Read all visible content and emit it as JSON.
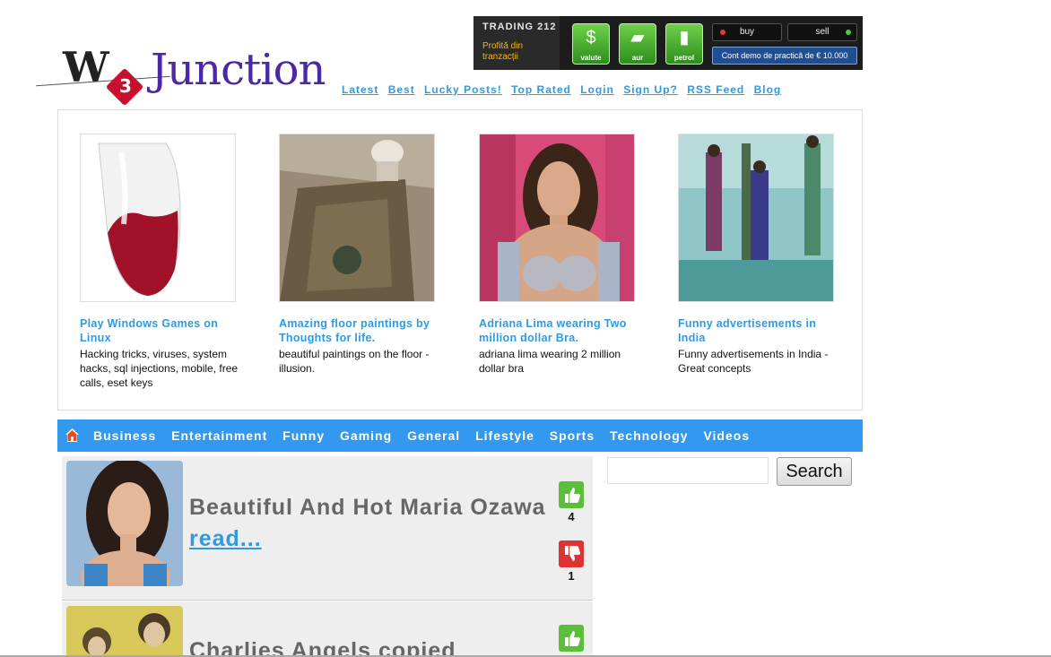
{
  "logo": {
    "w_text": "W",
    "number": "3",
    "name": "Junction"
  },
  "topnav": [
    "Latest",
    "Best",
    "Lucky Posts!",
    "Top Rated",
    "Login",
    "Sign Up?",
    "RSS Feed",
    "Blog"
  ],
  "ad": {
    "brand": "TRADING 212",
    "tagline": "Profită din tranzacții",
    "tiles": [
      {
        "label": "valute",
        "icon": "dollar-icon"
      },
      {
        "label": "aur",
        "icon": "gold-bar-icon"
      },
      {
        "label": "petrol",
        "icon": "oil-barrel-icon"
      }
    ],
    "buy": "buy",
    "sell": "sell",
    "demo": "Cont demo de practică de € 10.000",
    "colors": {
      "green": "#4cb82e",
      "navy": "#1f4f92"
    }
  },
  "featured": [
    {
      "title": "Play Windows Games on Linux",
      "desc": "Hacking tricks, viruses, system hacks, sql injections, mobile, free calls, eset keys",
      "image": "wine-glass-icon"
    },
    {
      "title": "Amazing floor paintings by Thoughts for life.",
      "desc": "beautiful paintings on the floor - illusion.",
      "image": "floor-painting-photo"
    },
    {
      "title": "Adriana Lima wearing Two million dollar Bra.",
      "desc": "adriana lima wearing 2 million dollar bra",
      "image": "portrait-photo"
    },
    {
      "title": "Funny advertisements in India",
      "desc": "Funny advertisements in India - Great concepts",
      "image": "street-photo"
    }
  ],
  "categories": [
    "Business",
    "Entertainment",
    "Funny",
    "Gaming",
    "General",
    "Lifestyle",
    "Sports",
    "Technology",
    "Videos"
  ],
  "posts": [
    {
      "title": "Beautiful And Hot Maria Ozawa",
      "read": "read...",
      "up": "4",
      "down": "1"
    },
    {
      "title": "Charlies Angels copied",
      "read": "",
      "up": "",
      "down": ""
    }
  ],
  "search": {
    "button": "Search",
    "placeholder": ""
  },
  "colors": {
    "accent": "#3399dd",
    "catbar": "#3399ee",
    "up": "#5bbf3a",
    "down": "#dd3333"
  }
}
